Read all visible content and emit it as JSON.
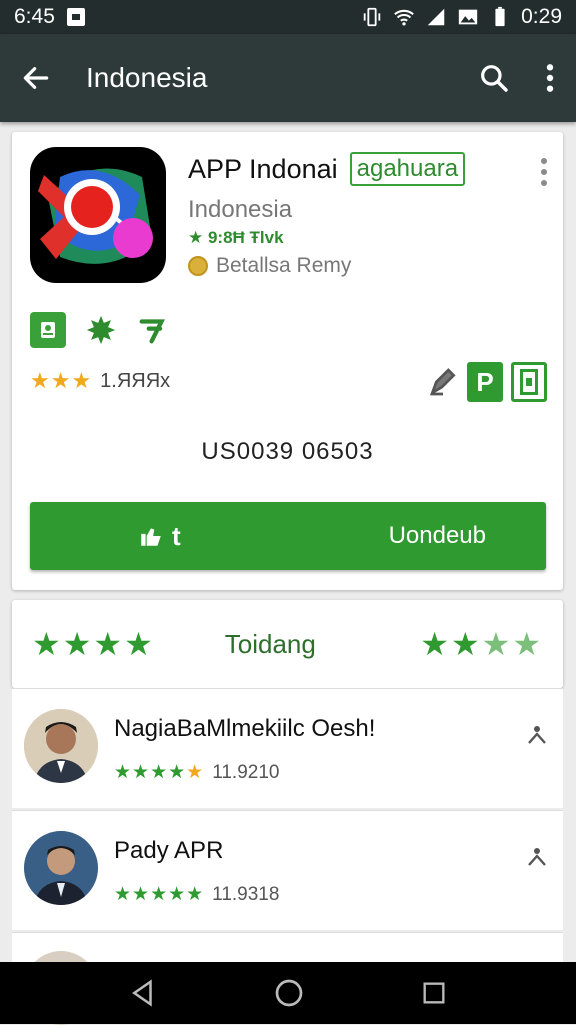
{
  "status": {
    "left_time": "6:45",
    "right_time": "0:29"
  },
  "app_bar": {
    "title": "Indonesia"
  },
  "app": {
    "title": "APP Indonai",
    "badge": "agahuara",
    "developer": "Indonesia",
    "meta": "★ 9:8Ħ Ŧlvk",
    "sub_label": "Betallsa Remy",
    "rating_count": "1.ЯЯЯx",
    "price": "US0039 06503",
    "install_left": "t",
    "install_label": "Uondeub"
  },
  "rating_bar": {
    "label": "Toidang"
  },
  "reviews": [
    {
      "name": "NagiaBaMlmekiilc Oesh!",
      "value": "11.9210"
    },
    {
      "name": "Pady APR",
      "value": "11.9318"
    }
  ],
  "colors": {
    "accent": "#2f9a2f",
    "app_bar": "#2e3a3a",
    "star_gold": "#f0a81c"
  }
}
